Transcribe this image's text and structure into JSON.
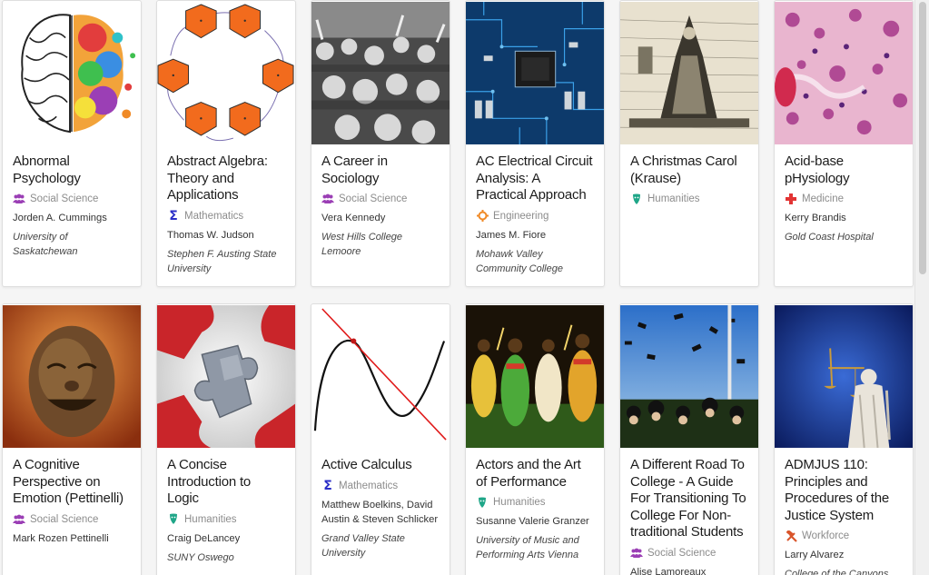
{
  "colors": {
    "social_science": "#9b3fb5",
    "mathematics": "#2a2ec7",
    "engineering": "#f08a26",
    "humanities": "#1fa688",
    "medicine": "#e23434",
    "workforce": "#d9552b"
  },
  "books": [
    {
      "title": "Abnormal Psychology",
      "subject": "Social Science",
      "subject_icon": "people-icon",
      "author": "Jorden A. Cummings",
      "institution": "University of Saskatchewan"
    },
    {
      "title": "Abstract Algebra: Theory and Applications",
      "subject": "Mathematics",
      "subject_icon": "sigma-icon",
      "author": "Thomas W. Judson",
      "institution": "Stephen F. Austing State University"
    },
    {
      "title": "A Career in Sociology",
      "subject": "Social Science",
      "subject_icon": "people-icon",
      "author": "Vera Kennedy",
      "institution": "West Hills College Lemoore"
    },
    {
      "title": "AC Electrical Circuit Analysis: A Practical Approach",
      "subject": "Engineering",
      "subject_icon": "gear-icon",
      "author": "James M. Fiore",
      "institution": "Mohawk Valley Community College"
    },
    {
      "title": "A Christmas Carol (Krause)",
      "subject": "Humanities",
      "subject_icon": "theater-mask-icon",
      "author": "",
      "institution": ""
    },
    {
      "title": "Acid-base pHysiology",
      "subject": "Medicine",
      "subject_icon": "medical-cross-icon",
      "author": "Kerry Brandis",
      "institution": "Gold Coast Hospital"
    },
    {
      "title": "A Cognitive Perspective on Emotion (Pettinelli)",
      "subject": "Social Science",
      "subject_icon": "people-icon",
      "author": "Mark Rozen Pettinelli",
      "institution": ""
    },
    {
      "title": "A Concise Introduction to Logic",
      "subject": "Humanities",
      "subject_icon": "theater-mask-icon",
      "author": "Craig DeLancey",
      "institution": "SUNY Oswego"
    },
    {
      "title": "Active Calculus",
      "subject": "Mathematics",
      "subject_icon": "sigma-icon",
      "author": "Matthew Boelkins, David Austin & Steven Schlicker",
      "institution": "Grand Valley State University"
    },
    {
      "title": "Actors and the Art of Performance",
      "subject": "Humanities",
      "subject_icon": "theater-mask-icon",
      "author": "Susanne Valerie Granzer",
      "institution": "University of Music and Performing Arts Vienna"
    },
    {
      "title": "A Different Road To College - A Guide For Transitioning To College For Non-traditional Students",
      "subject": "Social Science",
      "subject_icon": "people-icon",
      "author": "Alise Lamoreaux",
      "institution": ""
    },
    {
      "title": "ADMJUS 110: Principles and Procedures of the Justice System",
      "subject": "Workforce",
      "subject_icon": "hammer-icon",
      "author": "Larry Alvarez",
      "institution": "College of the Canyons"
    }
  ]
}
